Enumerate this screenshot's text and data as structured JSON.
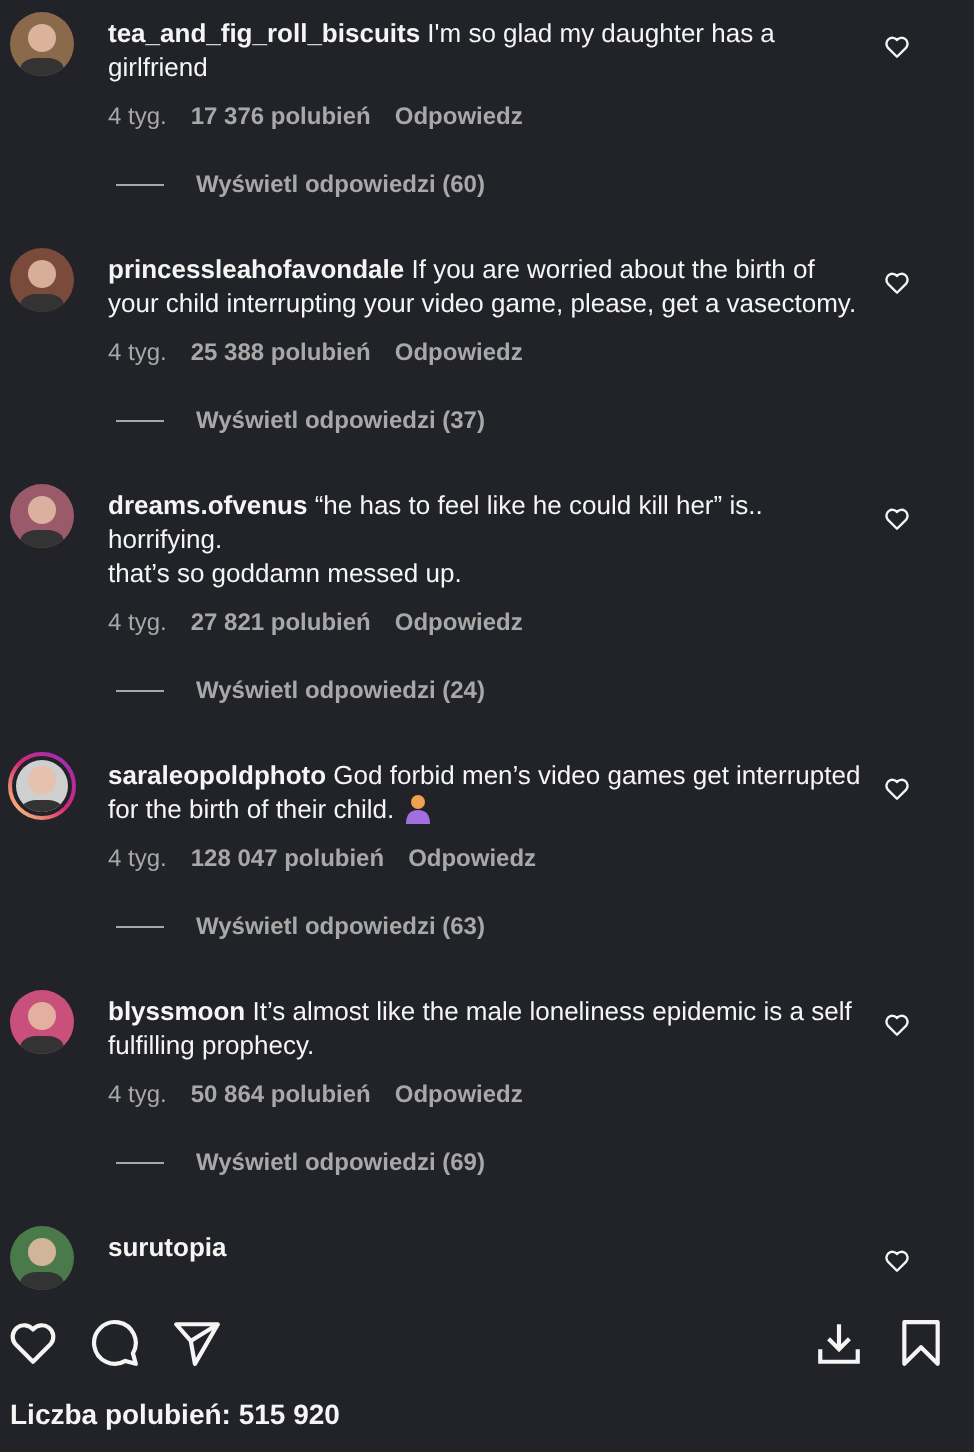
{
  "comments": [
    {
      "username": "tea_and_fig_roll_biscuits",
      "text": "I'm so glad my daughter has a girlfriend",
      "story_ring": false,
      "emoji": false,
      "time": "4 tyg.",
      "likes": "17 376 polubień",
      "reply": "Odpowiedz",
      "view_replies": "Wyświetl odpowiedzi (60)"
    },
    {
      "username": "princessleahofavondale",
      "text": "If you are worried about the birth of your child interrupting your video game, please, get a vasectomy.",
      "story_ring": false,
      "emoji": false,
      "time": "4 tyg.",
      "likes": "25 388 polubień",
      "reply": "Odpowiedz",
      "view_replies": "Wyświetl odpowiedzi (37)"
    },
    {
      "username": "dreams.ofvenus",
      "text": "“he has to feel like he could kill her” is.. horrifying.\nthat’s so goddamn messed up.",
      "story_ring": false,
      "emoji": false,
      "time": "4 tyg.",
      "likes": "27 821 polubień",
      "reply": "Odpowiedz",
      "view_replies": "Wyświetl odpowiedzi (24)"
    },
    {
      "username": "saraleopoldphoto",
      "text": "God forbid men’s video games get interrupted for the birth of their child.",
      "story_ring": true,
      "emoji": true,
      "time": "4 tyg.",
      "likes": "128 047 polubień",
      "reply": "Odpowiedz",
      "view_replies": "Wyświetl odpowiedzi (63)"
    },
    {
      "username": "blyssmoon",
      "text": "It’s almost like the male loneliness epidemic is a self fulfilling prophecy.",
      "story_ring": false,
      "emoji": false,
      "time": "4 tyg.",
      "likes": "50 864 polubień",
      "reply": "Odpowiedz",
      "view_replies": "Wyświetl odpowiedzi (69)"
    },
    {
      "username": "surutopia",
      "story_ring": false,
      "emoji": false
    }
  ],
  "likes_total": "Liczba polubień: 515 920"
}
